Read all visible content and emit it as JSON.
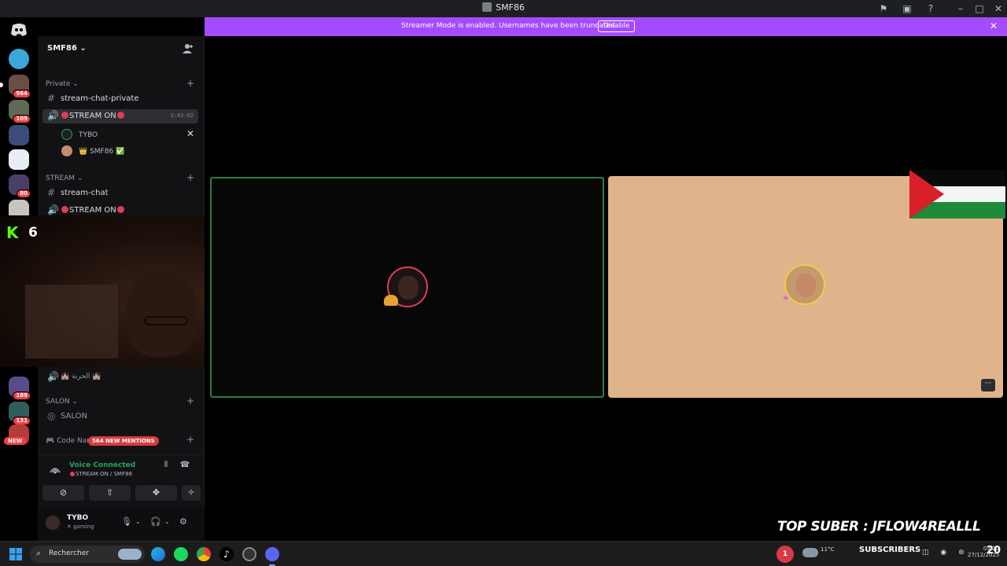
{
  "window": {
    "title": "SMF86"
  },
  "banner": {
    "text": "Streamer Mode is enabled. Usernames have been truncated.",
    "button": "Disable"
  },
  "rail": {
    "badges": [
      "564",
      "109",
      "80",
      "189",
      "131"
    ],
    "new_label": "NEW"
  },
  "server": {
    "name": "SMF86 ⌄"
  },
  "sidebar": {
    "private_cat": "Private ⌄",
    "private_channel": "stream-chat-private",
    "voice_active": "STREAM ON",
    "voice_timer": "3:43:02",
    "user1": "TYBO",
    "user2": "👑 SMF86 ✅",
    "stream_cat": "STREAM ⌄",
    "stream_channel": "stream-chat",
    "stream_voice": "STREAM ON",
    "arabic_channel": "🏰 الحربة 🏰",
    "salon_cat": "SALON ⌄",
    "salon_channel": "SALON",
    "code_cat": "🎮 Code Nan",
    "mentions": "564 NEW MENTIONS"
  },
  "voice_panel": {
    "status": "Voice Connected",
    "sub": "STREAM ON / SMF86"
  },
  "user": {
    "name": "TYBO",
    "status": "gaming"
  },
  "overlay": {
    "kick_count": "6",
    "top_suber": "TOP SUBER : JFLOW4REALLL"
  },
  "taskbar": {
    "search": "Rechercher",
    "notif_count": "1",
    "temp": "11°C",
    "subscribers": "SUBSCRIBERS",
    "time": "03:20",
    "date": "27/12/2025"
  },
  "colors": {
    "accent": "#a44bff",
    "speaking": "#2d7d46",
    "danger": "#f23f43"
  }
}
